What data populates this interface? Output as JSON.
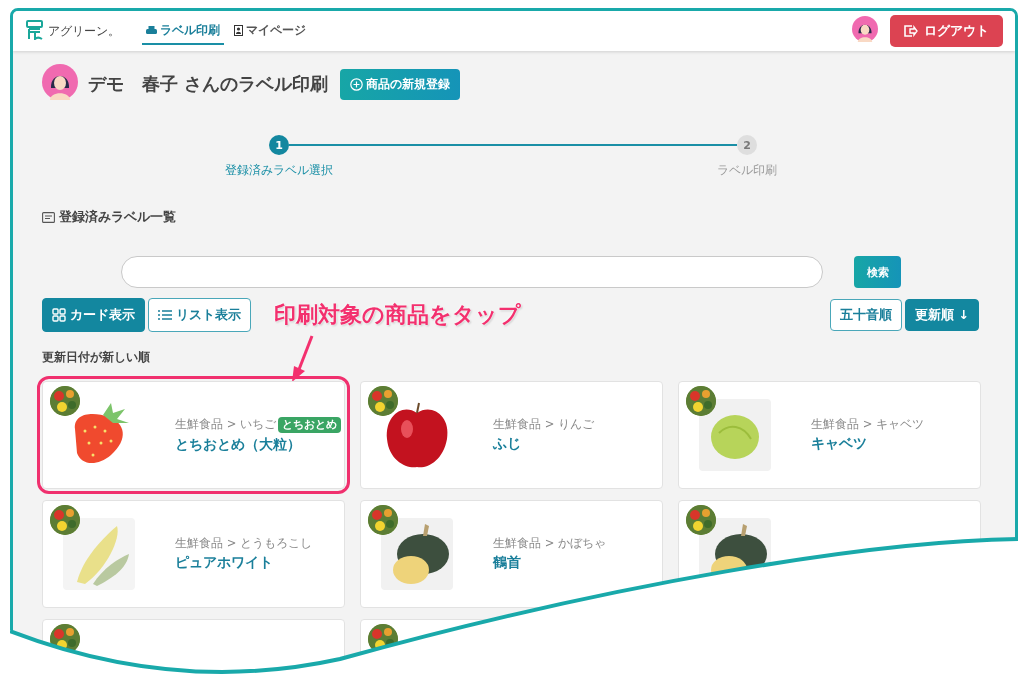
{
  "header": {
    "logo_text": "アグリーン。",
    "nav": [
      {
        "label": "ラベル印刷",
        "selected": true,
        "kind": "printer"
      },
      {
        "label": "マイページ",
        "selected": false,
        "kind": "profile"
      }
    ],
    "logout": "ログアウト"
  },
  "page_title": "デモ　春子 さんのラベル印刷",
  "new_button": "商品の新規登録",
  "steps": [
    {
      "number": "1",
      "label": "登録済みラベル選択",
      "active": true
    },
    {
      "number": "2",
      "label": "ラベル印刷",
      "active": false
    }
  ],
  "section_title": "登録済みラベル一覧",
  "search": {
    "button": "検索"
  },
  "view_modes": [
    {
      "label": "カード表示",
      "selected": true,
      "kind": "card"
    },
    {
      "label": "リスト表示",
      "selected": false,
      "kind": "list"
    }
  ],
  "sort_options": [
    {
      "label": "五十音順",
      "selected": false
    },
    {
      "label": "更新順 ↓",
      "selected": true
    }
  ],
  "annotation": "印刷対象の商品をタップ",
  "sort_caption": "更新日付が新しい順",
  "products": [
    {
      "kind": "strawberry",
      "category": "生鮮食品 > いちご",
      "tag": "とちおとめ",
      "name": "とちおとめ（大粒）",
      "highlighted": true
    },
    {
      "kind": "apple",
      "category": "生鮮食品 > りんご",
      "name": "ふじ",
      "highlighted": false
    },
    {
      "kind": "cabbage",
      "category": "生鮮食品 > キャベツ",
      "name": "キャベツ",
      "highlighted": false
    },
    {
      "kind": "corn",
      "category": "生鮮食品 > とうもろこし",
      "name": "ピュアホワイト",
      "highlighted": false
    },
    {
      "kind": "pumpkin",
      "category": "生鮮食品 > かぼちゃ",
      "name": "鶴首",
      "highlighted": false
    },
    {
      "kind": "pumpkin",
      "highlighted": false
    },
    {
      "kind": "empty",
      "highlighted": false
    },
    {
      "kind": "empty",
      "highlighted": false
    }
  ]
}
